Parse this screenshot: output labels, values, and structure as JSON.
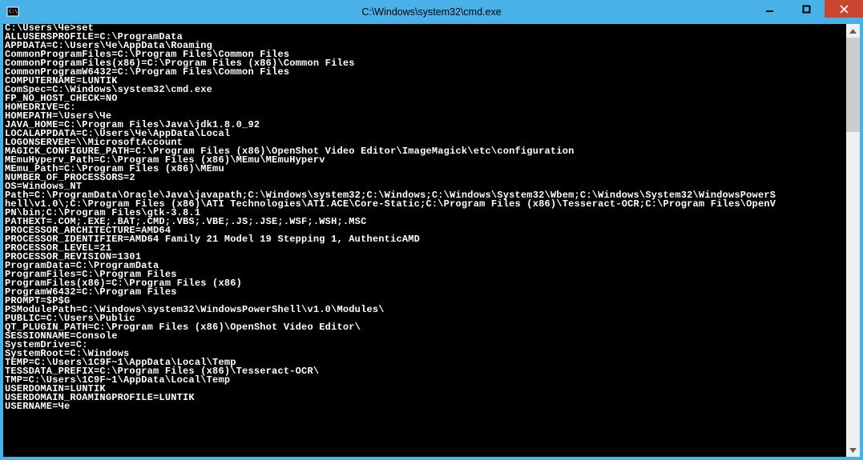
{
  "window": {
    "title": "C:\\Windows\\system32\\cmd.exe"
  },
  "console": {
    "lines": [
      "",
      "C:\\Users\\Че>set",
      "ALLUSERSPROFILE=C:\\ProgramData",
      "APPDATA=C:\\Users\\Че\\AppData\\Roaming",
      "CommonProgramFiles=C:\\Program Files\\Common Files",
      "CommonProgramFiles(x86)=C:\\Program Files (x86)\\Common Files",
      "CommonProgramW6432=C:\\Program Files\\Common Files",
      "COMPUTERNAME=LUNTIK",
      "ComSpec=C:\\Windows\\system32\\cmd.exe",
      "FP_NO_HOST_CHECK=NO",
      "HOMEDRIVE=C:",
      "HOMEPATH=\\Users\\Че",
      "JAVA_HOME=C:\\Program Files\\Java\\jdk1.8.0_92",
      "LOCALAPPDATA=C:\\Users\\Че\\AppData\\Local",
      "LOGONSERVER=\\\\MicrosoftAccount",
      "MAGICK_CONFIGURE_PATH=C:\\Program Files (x86)\\OpenShot Video Editor\\ImageMagick\\etc\\configuration",
      "MEmuHyperv_Path=C:\\Program Files (x86)\\MEmu\\MEmuHyperv",
      "MEmu_Path=C:\\Program Files (x86)\\MEmu",
      "NUMBER_OF_PROCESSORS=2",
      "OS=Windows_NT",
      "Path=C:\\ProgramData\\Oracle\\Java\\javapath;C:\\Windows\\system32;C:\\Windows;C:\\Windows\\System32\\Wbem;C:\\Windows\\System32\\WindowsPowerS",
      "hell\\v1.0\\;C:\\Program Files (x86)\\ATI Technologies\\ATI.ACE\\Core-Static;C:\\Program Files (x86)\\Tesseract-OCR;C:\\Program Files\\OpenV",
      "PN\\bin;C:\\Program Files\\gtk-3.8.1",
      "PATHEXT=.COM;.EXE;.BAT;.CMD;.VBS;.VBE;.JS;.JSE;.WSF;.WSH;.MSC",
      "PROCESSOR_ARCHITECTURE=AMD64",
      "PROCESSOR_IDENTIFIER=AMD64 Family 21 Model 19 Stepping 1, AuthenticAMD",
      "PROCESSOR_LEVEL=21",
      "PROCESSOR_REVISION=1301",
      "ProgramData=C:\\ProgramData",
      "ProgramFiles=C:\\Program Files",
      "ProgramFiles(x86)=C:\\Program Files (x86)",
      "ProgramW6432=C:\\Program Files",
      "PROMPT=$P$G",
      "PSModulePath=C:\\Windows\\system32\\WindowsPowerShell\\v1.0\\Modules\\",
      "PUBLIC=C:\\Users\\Public",
      "QT_PLUGIN_PATH=C:\\Program Files (x86)\\OpenShot Video Editor\\",
      "SESSIONNAME=Console",
      "SystemDrive=C:",
      "SystemRoot=C:\\Windows",
      "TEMP=C:\\Users\\1C9F~1\\AppData\\Local\\Temp",
      "TESSDATA_PREFIX=C:\\Program Files (x86)\\Tesseract-OCR\\",
      "TMP=C:\\Users\\1C9F~1\\AppData\\Local\\Temp",
      "USERDOMAIN=LUNTIK",
      "USERDOMAIN_ROAMINGPROFILE=LUNTIK",
      "USERNAME=Че"
    ]
  }
}
